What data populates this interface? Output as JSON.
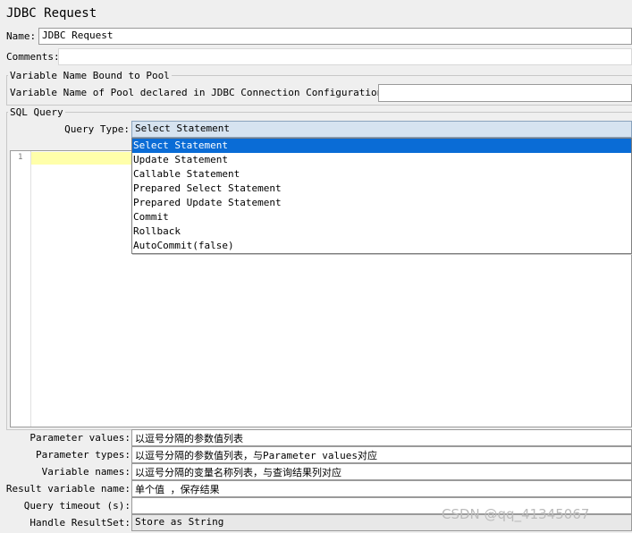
{
  "window": {
    "title": "JDBC Request"
  },
  "name": {
    "label": "Name:",
    "value": "JDBC Request"
  },
  "comments": {
    "label": "Comments:",
    "value": ""
  },
  "pool": {
    "legend": "Variable Name Bound to Pool",
    "label": "Variable Name of Pool declared in JDBC Connection Configuration:",
    "value": ""
  },
  "sql": {
    "legend": "SQL Query",
    "query_type_label": "Query Type:",
    "query_type_value": "Select Statement",
    "options": [
      "Select Statement",
      "Update Statement",
      "Callable Statement",
      "Prepared Select Statement",
      "Prepared Update Statement",
      "Commit",
      "Rollback",
      "AutoCommit(false)"
    ],
    "line_number": "1"
  },
  "params": [
    {
      "label": "Parameter values:",
      "value": "以逗号分隔的参数值列表"
    },
    {
      "label": "Parameter types:",
      "value": "以逗号分隔的参数值列表，与Parameter values对应"
    },
    {
      "label": "Variable names:",
      "value": "以逗号分隔的变量名称列表，与查询结果列对应"
    },
    {
      "label": "Result variable name:",
      "value": "单个值 ，保存结果"
    },
    {
      "label": "Query timeout (s):",
      "value": ""
    },
    {
      "label": "Handle ResultSet:",
      "value": "Store as String"
    }
  ],
  "watermark": "CSDN @qq_41345067"
}
